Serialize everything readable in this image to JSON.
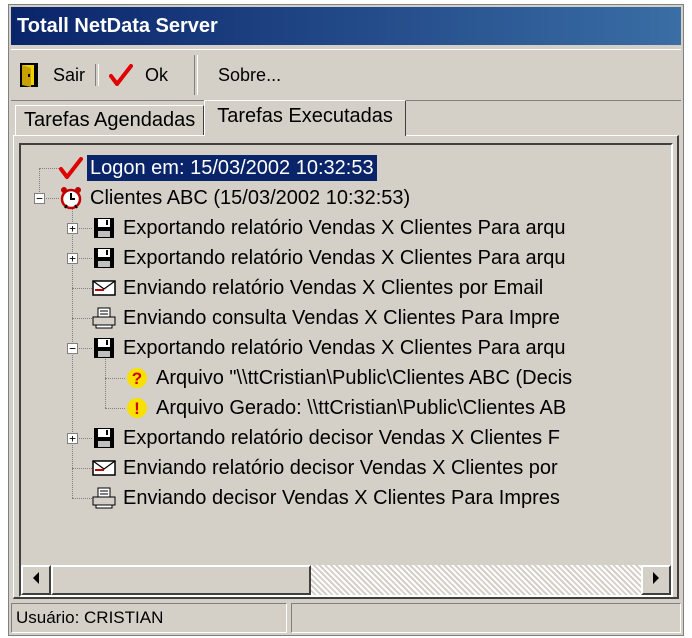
{
  "window": {
    "title": "Totall NetData Server"
  },
  "toolbar": {
    "exit_label": "Sair",
    "ok_label": "Ok",
    "about_label": "Sobre..."
  },
  "tabs": [
    {
      "label": "Tarefas Agendadas",
      "active": false
    },
    {
      "label": "Tarefas Executadas",
      "active": true
    }
  ],
  "tree": {
    "items": [
      {
        "text": "Logon em: 15/03/2002 10:32:53",
        "icon": "check-icon",
        "selected": true
      },
      {
        "text": "Clientes ABC (15/03/2002 10:32:53)",
        "icon": "alarm-clock-icon",
        "expander": "minus"
      },
      {
        "text": "Exportando relatório Vendas X Clientes Para arqu",
        "icon": "floppy-disk-icon",
        "expander": "plus"
      },
      {
        "text": "Exportando relatório Vendas X Clientes Para arqu",
        "icon": "floppy-disk-icon",
        "expander": "plus"
      },
      {
        "text": "Enviando relatório Vendas X Clientes por Email",
        "icon": "email-icon"
      },
      {
        "text": "Enviando consulta Vendas X Clientes Para Impre",
        "icon": "printer-icon"
      },
      {
        "text": "Exportando relatório Vendas X Clientes Para arqu",
        "icon": "floppy-disk-icon",
        "expander": "minus"
      },
      {
        "text": "Arquivo \"\\\\ttCristian\\Public\\Clientes ABC (Decis",
        "icon": "question-icon"
      },
      {
        "text": "Arquivo Gerado: \\\\ttCristian\\Public\\Clientes AB",
        "icon": "warning-icon"
      },
      {
        "text": "Exportando relatório decisor Vendas X Clientes F",
        "icon": "floppy-disk-icon",
        "expander": "plus"
      },
      {
        "text": "Enviando relatório decisor Vendas X Clientes por",
        "icon": "email-icon"
      },
      {
        "text": "Enviando decisor Vendas X Clientes Para Impres",
        "icon": "printer-icon"
      }
    ]
  },
  "statusbar": {
    "user": "Usuário: CRISTIAN",
    "extra": ""
  },
  "colors": {
    "title_start": "#0a246a",
    "title_end": "#3a6ea5",
    "selection": "#0a246a",
    "face": "#d4d0c8"
  }
}
